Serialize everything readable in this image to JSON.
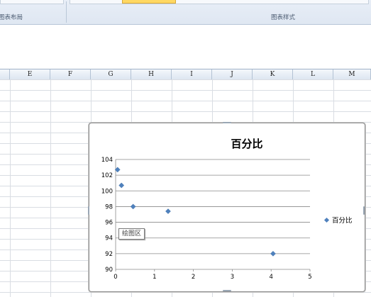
{
  "ribbon": {
    "group_left_label": "图表布局",
    "group_right_label": "图表样式"
  },
  "columns": [
    "E",
    "F",
    "G",
    "H",
    "I",
    "J",
    "K",
    "L",
    "M"
  ],
  "chart": {
    "tooltip": "绘图区",
    "legend_label": "百分比",
    "marker_color": "#4f81bd"
  },
  "chart_data": {
    "type": "scatter",
    "title": "百分比",
    "xlabel": "",
    "ylabel": "",
    "xlim": [
      0,
      5
    ],
    "ylim": [
      90,
      104
    ],
    "xticks": [
      0,
      1,
      2,
      3,
      4,
      5
    ],
    "yticks": [
      90,
      92,
      94,
      96,
      98,
      100,
      102,
      104
    ],
    "grid": true,
    "legend_position": "right",
    "series": [
      {
        "name": "百分比",
        "x": [
          0.05,
          0.15,
          0.45,
          1.35,
          4.05
        ],
        "y": [
          102.7,
          100.7,
          98.0,
          97.4,
          92.0
        ]
      }
    ]
  }
}
